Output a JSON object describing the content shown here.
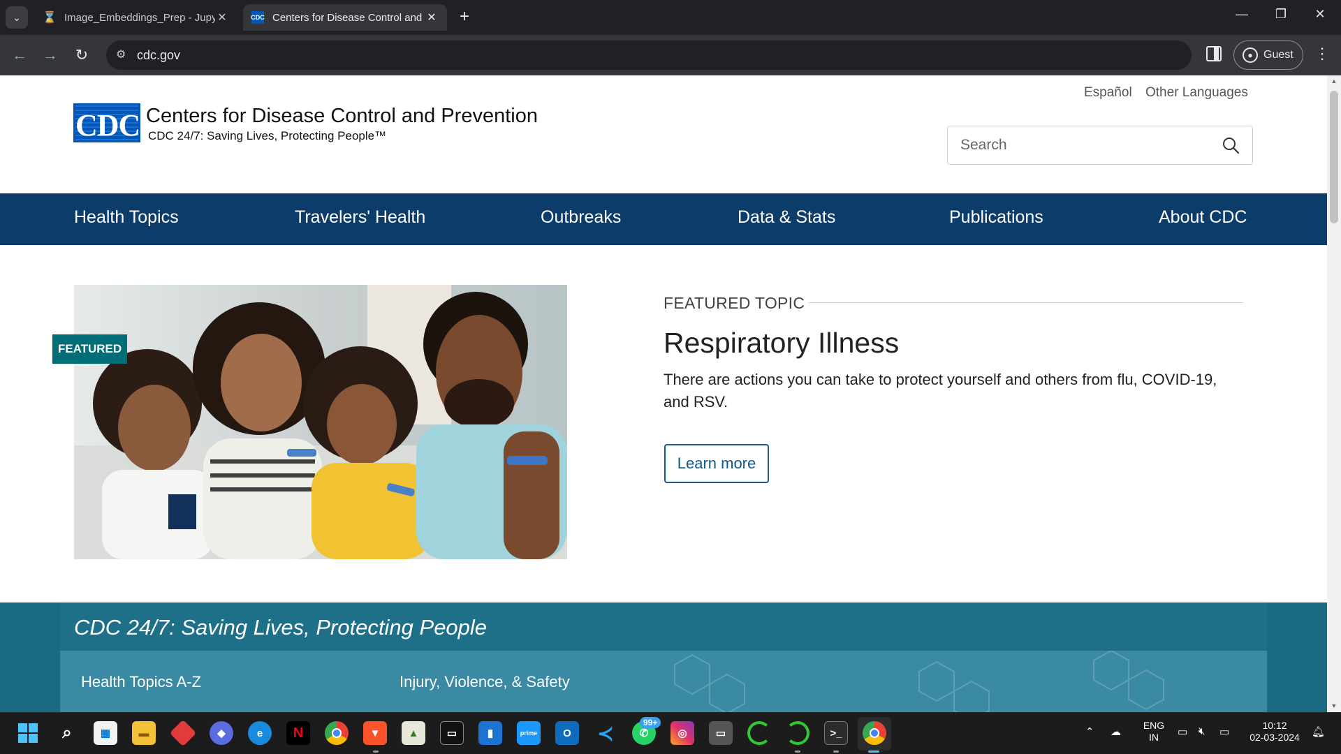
{
  "browser": {
    "tabs": [
      {
        "title": "Image_Embeddings_Prep - Jupyter"
      },
      {
        "title": "Centers for Disease Control and Prevention"
      }
    ],
    "favicon_cdc": "CDC",
    "url": "cdc.gov",
    "profile_label": "Guest",
    "new_tab": "+"
  },
  "header": {
    "logo_text": "CDC",
    "agency_name": "Centers for Disease Control and Prevention",
    "tagline": "CDC 24/7: Saving Lives, Protecting People™",
    "languages": [
      "Español",
      "Other Languages"
    ],
    "search_placeholder": "Search"
  },
  "nav": {
    "items": [
      "Health Topics",
      "Travelers' Health",
      "Outbreaks",
      "Data & Stats",
      "Publications",
      "About CDC"
    ]
  },
  "featured": {
    "tag": "FEATURED",
    "label": "FEATURED TOPIC",
    "title": "Respiratory Illness",
    "description": "There are actions you can take to protect yourself and others from flu, COVID-19, and RSV.",
    "button": "Learn more"
  },
  "band": {
    "heading": "CDC 24/7: Saving Lives, Protecting People",
    "links": [
      "Health Topics A-Z",
      "Injury, Violence, & Safety"
    ]
  },
  "taskbar": {
    "badge": "99+",
    "lang": "ENG",
    "region": "IN",
    "time": "10:12",
    "date": "02-03-2024"
  },
  "colors": {
    "nav_bg": "#0c3c6a",
    "featured_tag": "#006d77",
    "band": "#2b7e96",
    "logo_blue": "#0057b7"
  }
}
